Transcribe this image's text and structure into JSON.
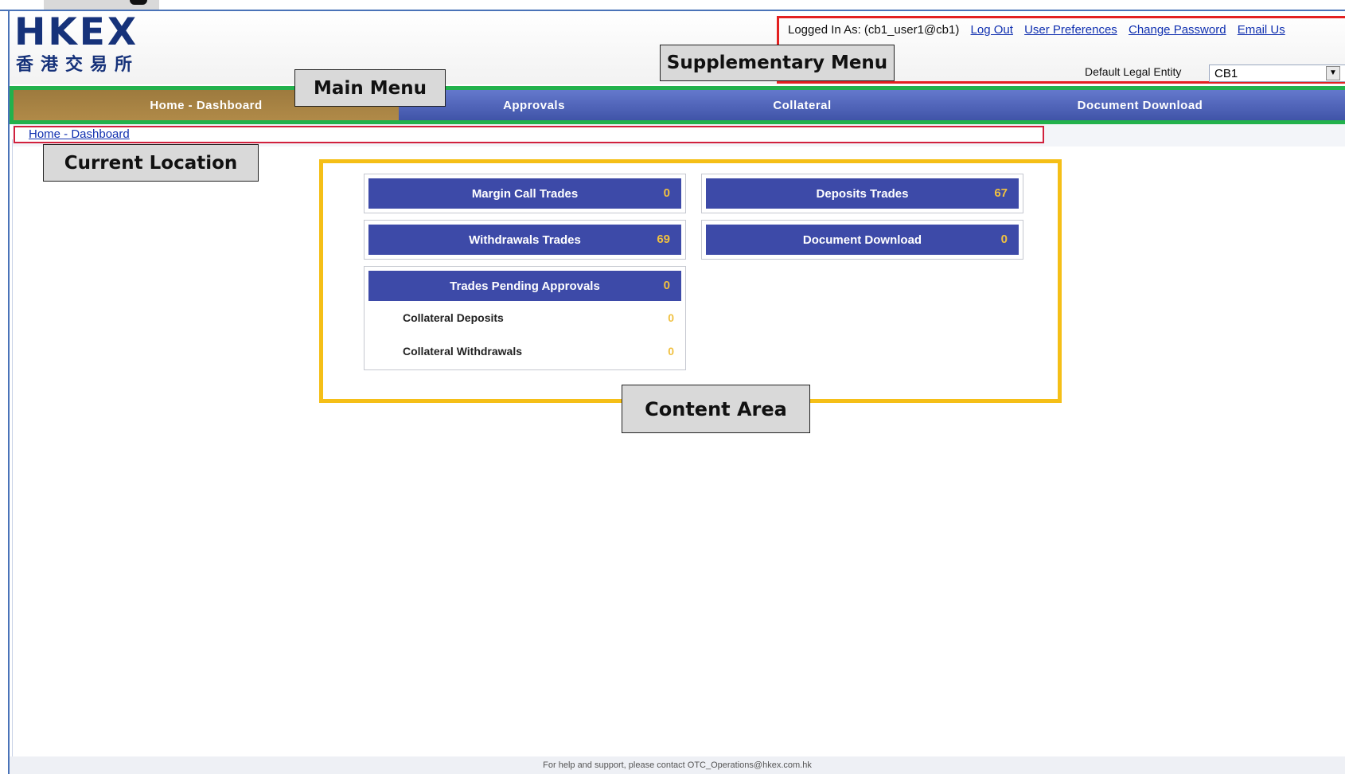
{
  "header": {
    "logo_en": "HKEX",
    "logo_zh": "香港交易所",
    "login_prefix": "Logged In As: (cb1_user1@cb1)",
    "links": [
      "Log Out",
      "User Preferences",
      "Change Password",
      "Email Us"
    ],
    "entity_label": "Default Legal Entity",
    "entity_value": "CB1"
  },
  "menu": {
    "items": [
      {
        "label": "Home - Dashboard",
        "active": true
      },
      {
        "label": "Approvals",
        "active": false
      },
      {
        "label": "Collateral",
        "active": false
      },
      {
        "label": "Document Download",
        "active": false
      }
    ]
  },
  "breadcrumb": {
    "label": "Home - Dashboard"
  },
  "callouts": {
    "supplementary_menu": "Supplementary Menu",
    "main_menu": "Main Menu",
    "current_location": "Current Location",
    "content_area": "Content Area"
  },
  "tiles": {
    "margin_call": {
      "label": "Margin Call Trades",
      "count": "0"
    },
    "deposits": {
      "label": "Deposits Trades",
      "count": "67"
    },
    "withdrawals": {
      "label": "Withdrawals Trades",
      "count": "69"
    },
    "document_download": {
      "label": "Document Download",
      "count": "0"
    },
    "pending": {
      "label": "Trades Pending Approvals",
      "count": "0",
      "rows": [
        {
          "label": "Collateral Deposits",
          "count": "0"
        },
        {
          "label": "Collateral Withdrawals",
          "count": "0"
        }
      ]
    }
  },
  "footer": {
    "text": "For help and support, please contact OTC_Operations@hkex.com.hk"
  },
  "colors": {
    "menu_active": "#a7823f",
    "menu_bg": "#4a5db6",
    "tile_head": "#3d4aa8",
    "count": "#f0c040",
    "supp_border": "#e32020",
    "menu_border": "#22b14c",
    "crumb_border": "#d1213d",
    "content_border": "#f5bf17"
  }
}
